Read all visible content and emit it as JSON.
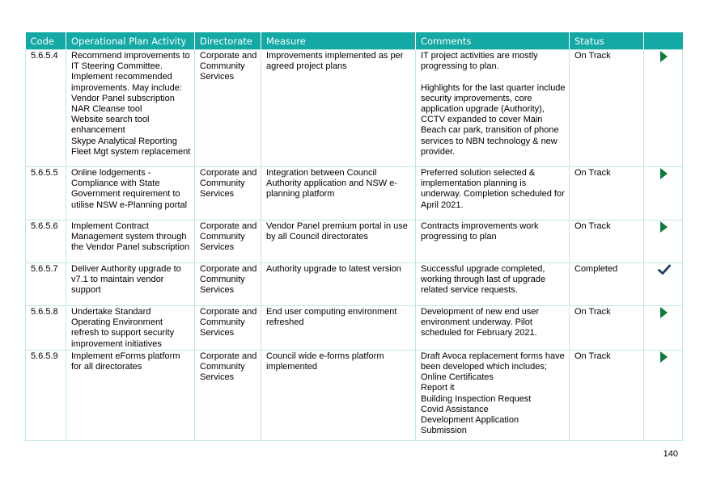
{
  "table": {
    "headers": [
      "Code",
      "Operational Plan Activity",
      "Directorate",
      "Measure",
      "Comments",
      "Status",
      ""
    ],
    "rows": [
      {
        "code": "5.6.5.4",
        "activity": [
          "Recommend improvements to IT Steering Committee. Implement recommended improvements. May include:",
          "Vendor Panel subscription",
          "NAR Cleanse tool",
          "Website search tool enhancement",
          "Skype Analytical Reporting",
          "Fleet Mgt system replacement"
        ],
        "directorate": "Corporate and Community Services",
        "measure": "Improvements implemented as per agreed project plans",
        "comments": [
          "IT project activities are mostly progressing to plan.",
          "",
          "Highlights for the last quarter include security improvements, core application upgrade (Authority), CCTV expanded to cover Main Beach car park, transition of phone services to NBN technology & new provider."
        ],
        "status": "On Track",
        "status_icon": "arrow-right-icon"
      },
      {
        "code": "5.6.5.5",
        "activity": [
          "Online lodgements - Compliance with State Government requirement to utilise NSW e-Planning portal"
        ],
        "directorate": "Corporate and Community Services",
        "measure": "Integration between Council Authority application and NSW e-planning platform",
        "comments": [
          "Preferred solution selected & implementation planning is underway. Completion scheduled for April 2021."
        ],
        "status": "On Track",
        "status_icon": "arrow-right-icon"
      },
      {
        "code": "5.6.5.6",
        "activity": [
          "Implement Contract Management system through the Vendor Panel subscription"
        ],
        "directorate": "Corporate and Community Services",
        "measure": "Vendor Panel premium portal in use by all Council directorates",
        "comments": [
          "Contracts improvements work progressing to plan"
        ],
        "status": "On Track",
        "status_icon": "arrow-right-icon"
      },
      {
        "code": "5.6.5.7",
        "activity": [
          "Deliver Authority upgrade to v7.1 to maintain vendor support"
        ],
        "directorate": "Corporate and Community Services",
        "measure": "Authority upgrade to latest version",
        "comments": [
          "Successful upgrade completed, working through last of upgrade related service requests."
        ],
        "status": "Completed",
        "status_icon": "checkmark-icon"
      },
      {
        "code": "5.6.5.8",
        "activity": [
          "Undertake Standard Operating Environment refresh to support security improvement initiatives"
        ],
        "directorate": "Corporate and Community Services",
        "measure": "End user computing environment refreshed",
        "comments": [
          "Development of new end user environment underway. Pilot scheduled for February 2021."
        ],
        "status": "On Track",
        "status_icon": "arrow-right-icon"
      },
      {
        "code": "5.6.5.9",
        "activity": [
          "Implement eForms platform for all directorates"
        ],
        "directorate": "Corporate and Community Services",
        "measure": "Council wide e-forms platform implemented",
        "comments": [
          "Draft Avoca replacement forms have been developed which includes;",
          "Online Certificates",
          "Report it",
          "Building Inspection Request",
          "Covid Assistance",
          "Development Application Submission"
        ],
        "status": "On Track",
        "status_icon": "arrow-right-icon"
      }
    ]
  },
  "colors": {
    "header_bg": "#14a9a5",
    "border": "#bfe7e6",
    "on_track_arrow": "#0e7a3b",
    "completed_check": "#1f3b63"
  },
  "page_number": "140"
}
